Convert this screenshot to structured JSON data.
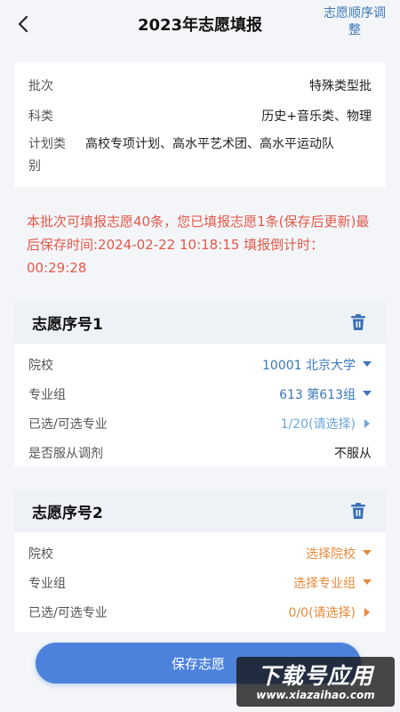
{
  "header": {
    "title": "2023年志愿填报",
    "order_link": "志愿顺序调整"
  },
  "info": {
    "batch_label": "批次",
    "batch_value": "特殊类型批",
    "subject_label": "科类",
    "subject_value": "历史+音乐类、物理",
    "plan_label": "计划类别",
    "plan_value": "高校专项计划、高水平艺术团、高水平运动队"
  },
  "notice": "本批次可填报志愿40条，您已填报志愿1条(保存后更新)最后保存时间:2024-02-22 10:18:15 填报倒计时：00:29:28",
  "volunteers": [
    {
      "title": "志愿序号1",
      "school_label": "院校",
      "school_value": "10001 北京大学",
      "group_label": "专业组",
      "group_value": "613 第613组",
      "major_label": "已选/可选专业",
      "major_value": "1/20(请选择)",
      "adjust_label": "是否服从调剂",
      "adjust_value": "不服从"
    },
    {
      "title": "志愿序号2",
      "school_label": "院校",
      "school_value": "选择院校",
      "group_label": "专业组",
      "group_value": "选择专业组",
      "major_label": "已选/可选专业",
      "major_value": "0/0(请选择)"
    }
  ],
  "save_button": "保存志愿",
  "watermark": {
    "main": "下载号应用",
    "sub": "www.xiazaihao.com"
  },
  "colors": {
    "accent": "#4d82dc",
    "link_blue": "#3a76b8",
    "notice_red": "#e2594a",
    "placeholder_orange": "#e58a3a"
  }
}
